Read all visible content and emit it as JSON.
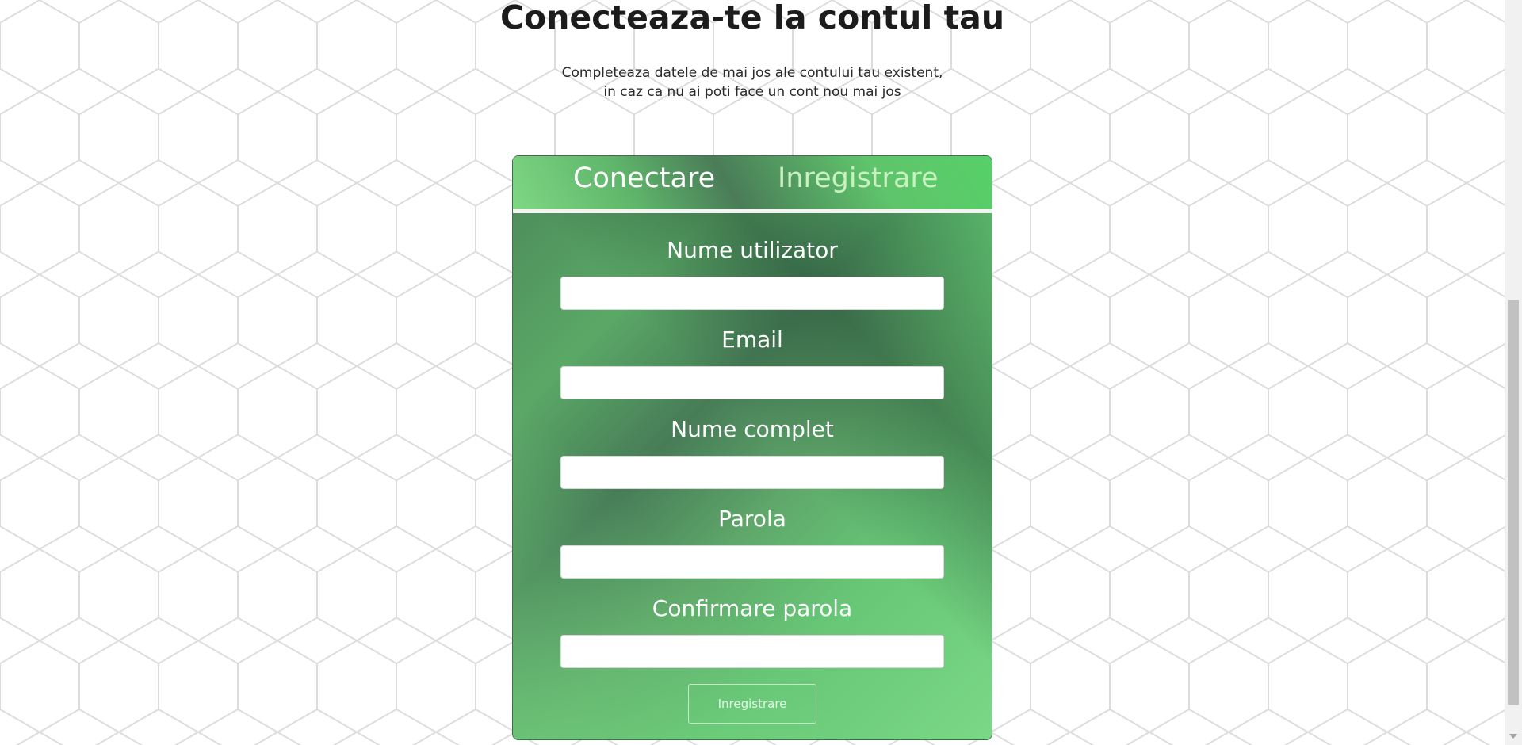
{
  "page": {
    "title": "Conecteaza-te la contul tau",
    "subtitle_line1": "Completeaza datele de mai jos ale contului tau existent,",
    "subtitle_line2": "in caz ca nu ai poti face un cont nou mai jos"
  },
  "tabs": [
    {
      "label": "Conectare",
      "active": true
    },
    {
      "label": "Inregistrare",
      "active": false
    }
  ],
  "form": {
    "fields": [
      {
        "label": "Nume utilizator",
        "value": ""
      },
      {
        "label": "Email",
        "value": ""
      },
      {
        "label": "Nume complet",
        "value": ""
      },
      {
        "label": "Parola",
        "value": ""
      },
      {
        "label": "Confirmare parola",
        "value": ""
      }
    ],
    "submit_label": "Inregistrare"
  },
  "colors": {
    "accent_green": "#5fc46b",
    "dark_green": "#477c57",
    "title": "#1c1c1c"
  },
  "icons": {
    "scroll_down": "chevron-down-icon"
  }
}
